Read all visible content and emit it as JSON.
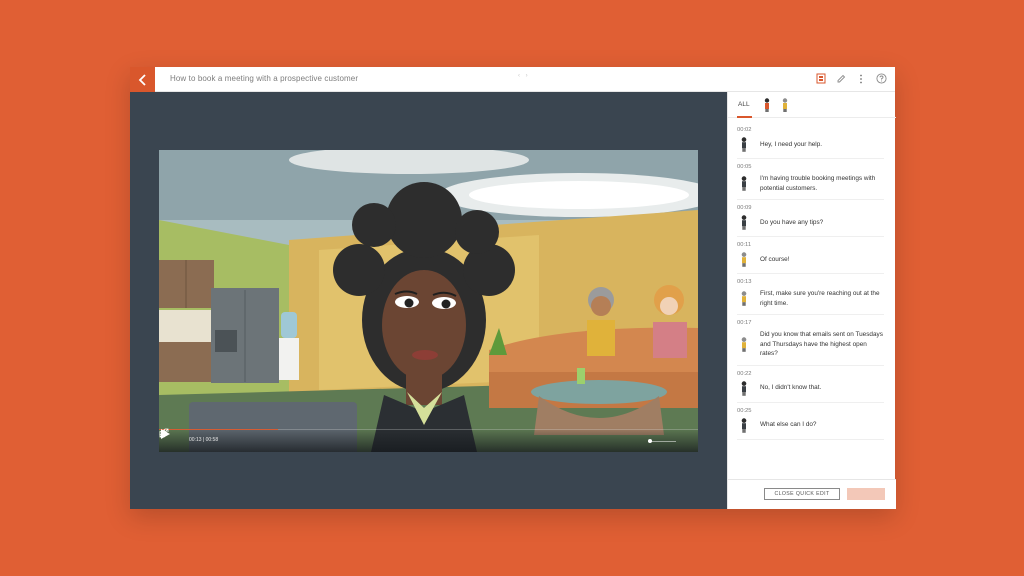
{
  "app": {
    "title": "How to book a meeting with a prospective customer",
    "nav_arrows": "‹ ›"
  },
  "colors": {
    "accent": "#d9572c",
    "background": "#e05f34",
    "stage": "#3a4550"
  },
  "toolbar": {
    "icons": [
      "scene-icon",
      "pencil-icon",
      "more-vert-icon",
      "help-icon"
    ]
  },
  "video": {
    "time": "00:13 | 00:58",
    "progress_fraction": 0.22,
    "volume_fraction": 0.0
  },
  "panel": {
    "tab_all": "ALL",
    "close_label": "CLOSE QUICK EDIT",
    "entries": [
      {
        "time": "00:02",
        "speaker": "female",
        "text": "Hey, I need your help."
      },
      {
        "time": "00:05",
        "speaker": "female",
        "text": "I'm having trouble booking meetings with potential customers."
      },
      {
        "time": "00:09",
        "speaker": "female",
        "text": "Do you have any tips?"
      },
      {
        "time": "00:11",
        "speaker": "male",
        "text": "Of course!"
      },
      {
        "time": "00:13",
        "speaker": "male",
        "text": "First, make sure you're reaching out at the right time."
      },
      {
        "time": "00:17",
        "speaker": "male",
        "text": "Did you know that emails sent on Tuesdays and Thursdays have the highest open rates?"
      },
      {
        "time": "00:22",
        "speaker": "female",
        "text": "No, I didn't know that."
      },
      {
        "time": "00:25",
        "speaker": "female",
        "text": "What else can I do?"
      }
    ]
  }
}
